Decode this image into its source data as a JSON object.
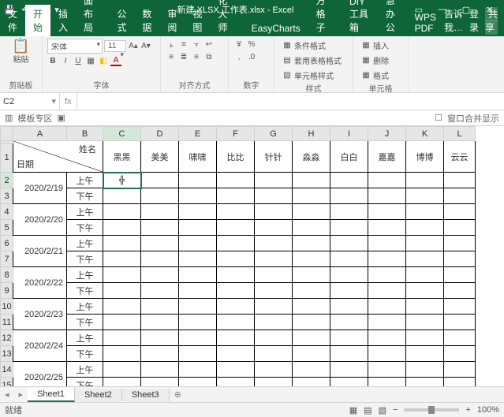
{
  "titlebar": {
    "title": "新建 XLSX 工作表.xlsx - Excel",
    "auto": "⎋"
  },
  "tabs": {
    "file": "文件",
    "home": "开始",
    "insert": "插入",
    "pagelayout": "页面布局",
    "formulas": "公式",
    "data": "数据",
    "review": "审阅",
    "view": "视图",
    "beautify": "美化大师",
    "easycharts": "EasyCharts",
    "fanggezi": "方方格子",
    "diy": "DIY工具箱",
    "huiban": "慧办公",
    "wpspdf": "WPS PDF",
    "tell": "告诉我…",
    "login": "登录",
    "share": "共享"
  },
  "ribbon": {
    "clipboard": {
      "paste": "粘贴",
      "label": "剪贴板"
    },
    "font": {
      "name": "宋体",
      "size": "11",
      "label": "字体"
    },
    "align": {
      "label": "对齐方式"
    },
    "number": {
      "label": "数字"
    },
    "styles": {
      "cond": "条件格式",
      "tbl": "套用表格格式",
      "cellstyle": "单元格样式",
      "label": "样式"
    },
    "cells": {
      "insert": "插入",
      "delete": "删除",
      "format": "格式",
      "label": "单元格"
    }
  },
  "namebox": "C2",
  "formula": "",
  "templbar": {
    "label": "模板专区",
    "right": "窗口合并显示"
  },
  "columns": [
    "A",
    "B",
    "C",
    "D",
    "E",
    "F",
    "G",
    "H",
    "I",
    "J",
    "K",
    "L"
  ],
  "header": {
    "name": "姓名",
    "date": "日期",
    "people": [
      "黑黑",
      "美美",
      "啸啸",
      "比比",
      "针针",
      "淼淼",
      "白白",
      "嘉嘉",
      "博博",
      "云云"
    ]
  },
  "periods": {
    "am": "上午",
    "pm": "下午"
  },
  "dates": [
    "2020/2/19",
    "2020/2/20",
    "2020/2/21",
    "2020/2/22",
    "2020/2/23",
    "2020/2/24",
    "2020/2/25"
  ],
  "sheets": {
    "s1": "Sheet1",
    "s2": "Sheet2",
    "s3": "Sheet3"
  },
  "status": {
    "ready": "就绪",
    "zoom": "100%"
  },
  "icons": {
    "save": "💾",
    "undo": "↶",
    "redo": "↷",
    "paste": "📋",
    "cut": "✂",
    "copy": "⧉",
    "brush": "🖌",
    "bold": "B",
    "italic": "I",
    "underline": "U",
    "border": "▦",
    "fill": "◧",
    "fontcolor": "A",
    "alignL": "≡",
    "merge": "⧉",
    "wrap": "↩",
    "fx": "fx",
    "plus": "⊕",
    "cursor": "╬"
  }
}
